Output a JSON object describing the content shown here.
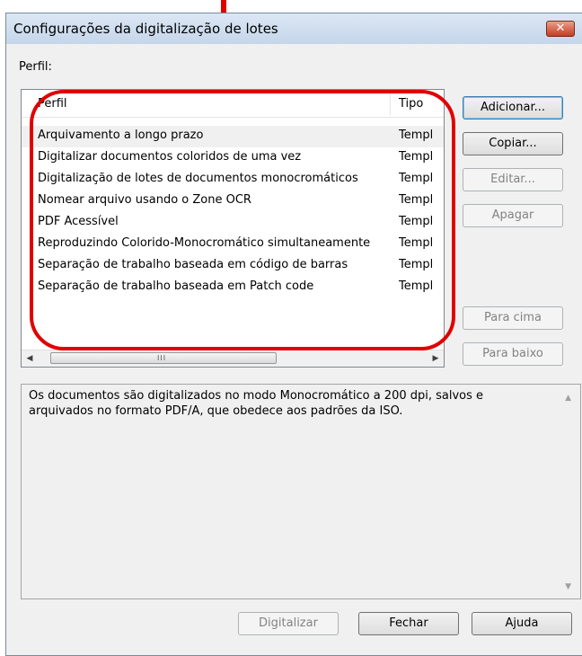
{
  "window": {
    "title": "Configurações da digitalização de lotes",
    "close_glyph": "✕"
  },
  "perfil_label": "Perfil:",
  "list": {
    "columns": [
      "Perfil",
      "Tipo"
    ],
    "rows": [
      {
        "name": "Arquivamento a longo prazo",
        "type": "Templ",
        "selected": true
      },
      {
        "name": "Digitalizar documentos coloridos de uma vez",
        "type": "Templ"
      },
      {
        "name": "Digitalização de lotes de documentos monocromáticos",
        "type": "Templ"
      },
      {
        "name": "Nomear arquivo usando o Zone OCR",
        "type": "Templ"
      },
      {
        "name": "PDF Acessível",
        "type": "Templ"
      },
      {
        "name": "Reproduzindo Colorido-Monocromático simultaneamente",
        "type": "Templ"
      },
      {
        "name": "Separação de trabalho baseada em código de barras",
        "type": "Templ"
      },
      {
        "name": "Separação de trabalho baseada em Patch code",
        "type": "Templ"
      }
    ],
    "scroll_left": "◀",
    "scroll_right": "▶",
    "scroll_grip": "III"
  },
  "buttons": {
    "adicionar": "Adicionar...",
    "copiar": "Copiar...",
    "editar": "Editar...",
    "apagar": "Apagar",
    "para_cima": "Para cima",
    "para_baixo": "Para baixo",
    "digitalizar": "Digitalizar",
    "fechar": "Fechar",
    "ajuda": "Ajuda"
  },
  "description": {
    "text": "Os documentos são digitalizados no modo Monocromático a 200 dpi,  salvos e arquivados no formato PDF/A, que obedece aos padrões da ISO.",
    "scroll_up": "▲",
    "scroll_down": "▼"
  },
  "colors": {
    "annotation": "#e00000",
    "window_bg": "#f0f0f0",
    "close_button": "#c63a24"
  },
  "icons": {
    "close": "close-icon"
  }
}
